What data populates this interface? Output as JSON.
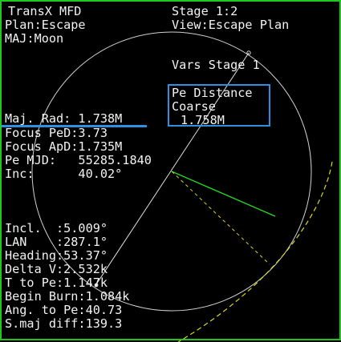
{
  "header": {
    "title": "TransX MFD",
    "plan": "Plan:Escape",
    "major_body": "MAJ:Moon",
    "stage": "Stage 1:2",
    "view": "View:Escape Plan"
  },
  "vars_stage": "Vars Stage 1",
  "selected_param": {
    "name": "Pe Distance",
    "mode": "Coarse",
    "value": "1.758M"
  },
  "readouts_top": [
    "Maj. Rad: 1.738M",
    "Focus PeD:3.73",
    "Focus ApD:1.735M",
    "Pe MJD:   55285.1840",
    "Inc:      40.02°"
  ],
  "readouts_bottom": [
    "Incl.  :5.009°",
    "LAN    :287.1°",
    "Heading:53.37°",
    "Delta V:2.532k",
    "T to Pe:1.147k",
    "Begin Burn:1.084k",
    "Ang. to Pe:40.73",
    "S.maj diff:139.3"
  ],
  "colors": {
    "frame": "#1ec81e",
    "text": "#f2f2f2",
    "highlight": "#2f8fe0",
    "orbit": "#d0d0d0",
    "velocity_vector": "#22dd22",
    "target_orbit": "#d8d820"
  }
}
